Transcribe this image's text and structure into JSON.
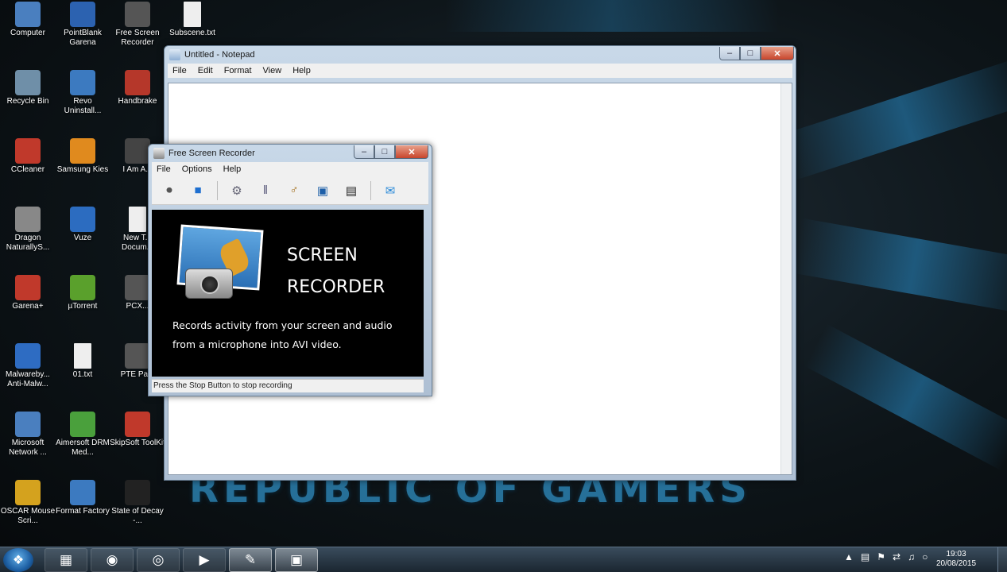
{
  "desktop": {
    "wallpaper_text": "REPUBLIC OF GAMERS",
    "icons": [
      {
        "label": "Computer",
        "icon": "computer-icon",
        "color": "#4a7fbf"
      },
      {
        "label": "PointBlank Garena",
        "icon": "pointblank-icon",
        "color": "#2c62b0"
      },
      {
        "label": "Free Screen Recorder",
        "icon": "recorder-icon",
        "color": "#555"
      },
      {
        "label": "Subscene.txt",
        "icon": "text-file-icon",
        "color": "#eeeeee"
      },
      {
        "label": "Recycle Bin",
        "icon": "recycle-bin-icon",
        "color": "#6f8fa8"
      },
      {
        "label": "Revo Uninstall...",
        "icon": "revo-icon",
        "color": "#3c7ac0"
      },
      {
        "label": "Handbrake",
        "icon": "handbrake-icon",
        "color": "#b5372a"
      },
      {
        "label": "CCleaner",
        "icon": "ccleaner-icon",
        "color": "#c0392b"
      },
      {
        "label": "Samsung Kies",
        "icon": "kies-icon",
        "color": "#e08a1e"
      },
      {
        "label": "I Am A...",
        "icon": "game-icon",
        "color": "#444"
      },
      {
        "label": "Dragon NaturallyS...",
        "icon": "dragon-icon",
        "color": "#888"
      },
      {
        "label": "Vuze",
        "icon": "vuze-icon",
        "color": "#2c6cc0"
      },
      {
        "label": "New T... Docum...",
        "icon": "text-file-icon",
        "color": "#eeeeee"
      },
      {
        "label": "Garena+",
        "icon": "garena-icon",
        "color": "#c0392b"
      },
      {
        "label": "µTorrent",
        "icon": "utorrent-icon",
        "color": "#5aa02c"
      },
      {
        "label": "PCX...",
        "icon": "pcx-icon",
        "color": "#555"
      },
      {
        "label": "Malwareby... Anti-Malw...",
        "icon": "malwarebytes-icon",
        "color": "#2e6cc2"
      },
      {
        "label": "01.txt",
        "icon": "text-file-icon",
        "color": "#eeeeee"
      },
      {
        "label": "PTE Pa...",
        "icon": "pte-icon",
        "color": "#555"
      },
      {
        "label": "Microsoft Network ...",
        "icon": "network-icon",
        "color": "#4a7fbf"
      },
      {
        "label": "Aimersoft DRM Med...",
        "icon": "aimersoft-icon",
        "color": "#4aa03c"
      },
      {
        "label": "SkipSoft ToolKit",
        "icon": "skipsoft-icon",
        "color": "#c0392b"
      },
      {
        "label": "OSCAR Mouse Scri...",
        "icon": "oscar-icon",
        "color": "#d4a21e"
      },
      {
        "label": "Format Factory",
        "icon": "formatfactory-icon",
        "color": "#3c7ac0"
      },
      {
        "label": "State of Decay -...",
        "icon": "stateofdecay-icon",
        "color": "#222"
      }
    ]
  },
  "notepad": {
    "title": "Untitled - Notepad",
    "menu": [
      "File",
      "Edit",
      "Format",
      "View",
      "Help"
    ],
    "controls": {
      "min": "–",
      "max": "□",
      "close": "✕"
    }
  },
  "recorder": {
    "title": "Free Screen Recorder",
    "menu": [
      "File",
      "Options",
      "Help"
    ],
    "toolbar": [
      {
        "icon": "record-icon",
        "glyph": "⏺"
      },
      {
        "icon": "stop-icon",
        "glyph": "■"
      },
      {
        "icon": "settings-gear-icon",
        "glyph": "⚙"
      },
      {
        "icon": "film-strip-icon",
        "glyph": "‖"
      },
      {
        "icon": "microphone-icon",
        "glyph": "♂"
      },
      {
        "icon": "screen-capture-icon",
        "glyph": "▣"
      },
      {
        "icon": "clapperboard-icon",
        "glyph": "▤"
      },
      {
        "icon": "chat-bubble-icon",
        "glyph": "✉"
      }
    ],
    "banner_title_1": "SCREEN",
    "banner_title_2": "RECORDER",
    "banner_line_1": "Records activity from your screen and audio",
    "banner_line_2": "from a microphone into AVI video.",
    "status": "Press the Stop Button to stop recording"
  },
  "taskbar": {
    "start_glyph": "❖",
    "buttons": [
      {
        "icon": "file-explorer-icon",
        "glyph": "▦"
      },
      {
        "icon": "firefox-icon",
        "glyph": "◉"
      },
      {
        "icon": "chrome-icon",
        "glyph": "◎"
      },
      {
        "icon": "media-player-icon",
        "glyph": "▶"
      },
      {
        "icon": "notepad-taskbar-icon",
        "glyph": "✎"
      },
      {
        "icon": "recorder-taskbar-icon",
        "glyph": "▣"
      }
    ],
    "tray": [
      "▲",
      "▤",
      "⚑",
      "⇄",
      "♫",
      "○"
    ],
    "time": "19:03",
    "date": "20/08/2015"
  }
}
